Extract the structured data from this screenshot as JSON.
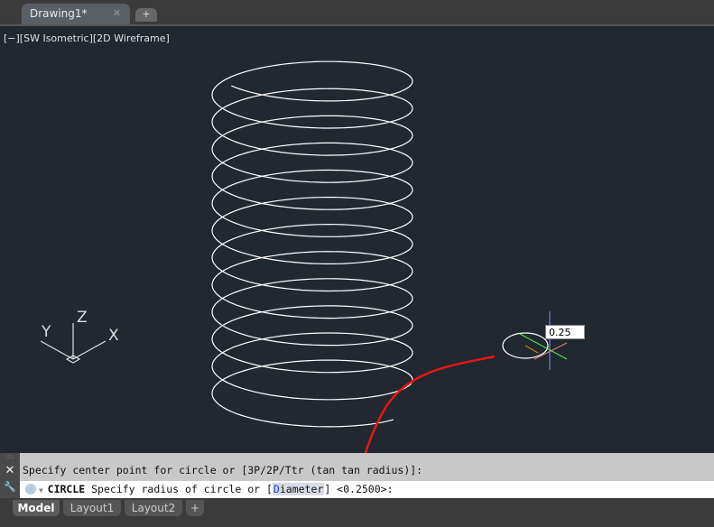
{
  "tabs": {
    "document": "Drawing1*",
    "close": "✕",
    "new": "+"
  },
  "viewport": {
    "label": "[−][SW Isometric][2D Wireframe]",
    "tooltip_value": "0.25",
    "ucs": {
      "x": "X",
      "y": "Y",
      "z": "Z"
    }
  },
  "command": {
    "history": "Specify center point for circle or [3P/2P/Ttr (tan tan radius)]:",
    "name": "CIRCLE",
    "prompt": "Specify radius of circle or [",
    "option_first": "D",
    "option_rest": "iameter",
    "suffix": "] <0.2500>:",
    "close": "✕",
    "settings": "🔧"
  },
  "layouts": [
    "Model",
    "Layout1",
    "Layout2",
    "+"
  ],
  "colors": {
    "background": "#212830",
    "helix": "#ffffff",
    "annotation": "#e8151b"
  }
}
